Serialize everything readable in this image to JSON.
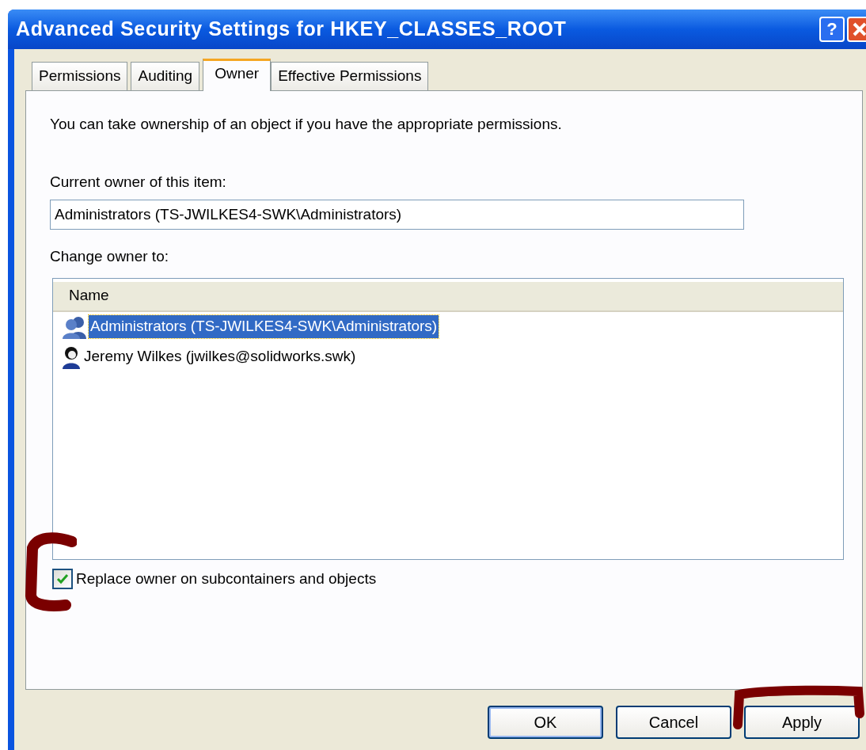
{
  "window": {
    "title": "Advanced Security Settings for HKEY_CLASSES_ROOT",
    "help_button": "?"
  },
  "tabs": [
    {
      "label": "Permissions",
      "selected": false
    },
    {
      "label": "Auditing",
      "selected": false
    },
    {
      "label": "Owner",
      "selected": true
    },
    {
      "label": "Effective Permissions",
      "selected": false
    }
  ],
  "intro": "You can take ownership of an object if you have the appropriate permissions.",
  "current_owner": {
    "label": "Current owner of this item:",
    "value": "Administrators (TS-JWILKES4-SWK\\Administrators)"
  },
  "change_owner": {
    "label": "Change owner to:",
    "column": "Name",
    "rows": [
      {
        "kind": "group",
        "name": "Administrators (TS-JWILKES4-SWK\\Administrators)",
        "selected": true
      },
      {
        "kind": "user",
        "name": "Jeremy Wilkes (jwilkes@solidworks.swk)",
        "selected": false
      }
    ]
  },
  "replace_owner": {
    "label": "Replace owner on subcontainers and objects",
    "checked": true
  },
  "buttons": [
    {
      "label": "OK",
      "default": true
    },
    {
      "label": "Cancel",
      "default": false
    },
    {
      "label": "Apply",
      "default": false
    }
  ]
}
